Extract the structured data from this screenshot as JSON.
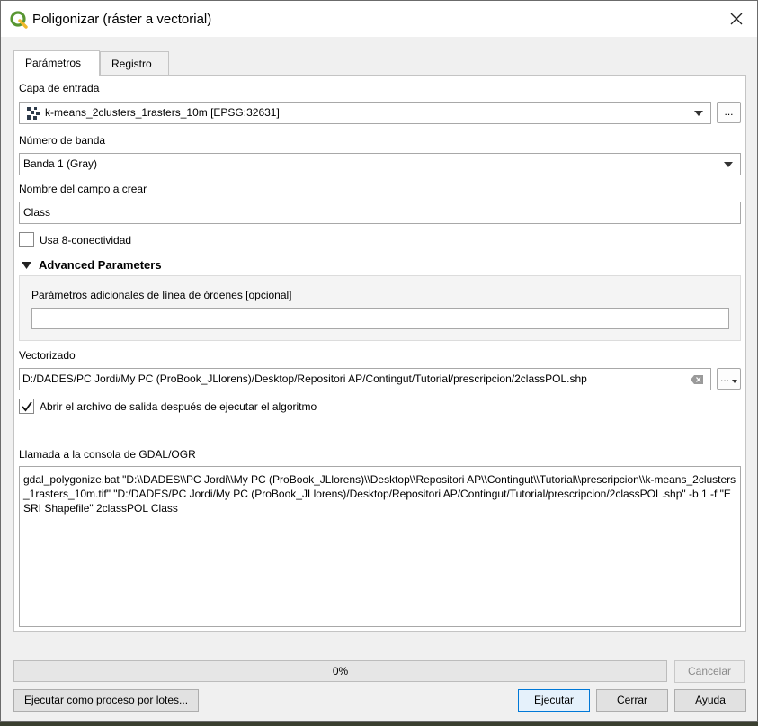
{
  "window": {
    "title": "Poligonizar (ráster a vectorial)"
  },
  "tabs": [
    {
      "label": "Parámetros",
      "active": true
    },
    {
      "label": "Registro",
      "active": false
    }
  ],
  "params": {
    "input_layer": {
      "label": "Capa de entrada",
      "value": "k-means_2clusters_1rasters_10m [EPSG:32631]",
      "browse_label": "..."
    },
    "band": {
      "label": "Número de banda",
      "value": "Banda 1 (Gray)"
    },
    "field_name": {
      "label": "Nombre del campo a crear",
      "value": "Class"
    },
    "eight_connectedness": {
      "label": "Usa 8-conectividad",
      "checked": false
    },
    "advanced": {
      "label": "Advanced Parameters",
      "extra_label": "Parámetros adicionales de línea de órdenes [opcional]",
      "extra_value": ""
    },
    "output": {
      "label": "Vectorizado",
      "value": "D:/DADES/PC Jordi/My PC (ProBook_JLlorens)/Desktop/Repositori AP/Contingut/Tutorial/prescripcion/2classPOL.shp",
      "browse_label": "..."
    },
    "open_output": {
      "label": "Abrir el archivo de salida después de ejecutar el algoritmo",
      "checked": true
    },
    "console": {
      "label": "Llamada a la consola de GDAL/OGR",
      "value": "gdal_polygonize.bat \"D:\\\\DADES\\\\PC Jordi\\\\My PC (ProBook_JLlorens)\\\\Desktop\\\\Repositori AP\\\\Contingut\\\\Tutorial\\\\prescripcion\\\\k-means_2clusters_1rasters_10m.tif\" \"D:/DADES/PC Jordi/My PC (ProBook_JLlorens)/Desktop/Repositori AP/Contingut/Tutorial/prescripcion/2classPOL.shp\" -b 1 -f \"ESRI Shapefile\" 2classPOL Class"
    }
  },
  "footer": {
    "progress_text": "0%",
    "progress_value": 0,
    "cancel_label": "Cancelar",
    "batch_label": "Ejecutar como proceso por lotes...",
    "run_label": "Ejecutar",
    "close_label": "Cerrar",
    "help_label": "Ayuda"
  },
  "colors": {
    "accent": "#0078d7",
    "qgis_green": "#589632",
    "qgis_yellow": "#f0b92b"
  },
  "icons": [
    "qgis-logo-icon",
    "close-icon",
    "raster-layer-icon",
    "dropdown-arrow-icon",
    "clear-field-icon",
    "collapse-triangle-icon",
    "checkmark-icon"
  ]
}
